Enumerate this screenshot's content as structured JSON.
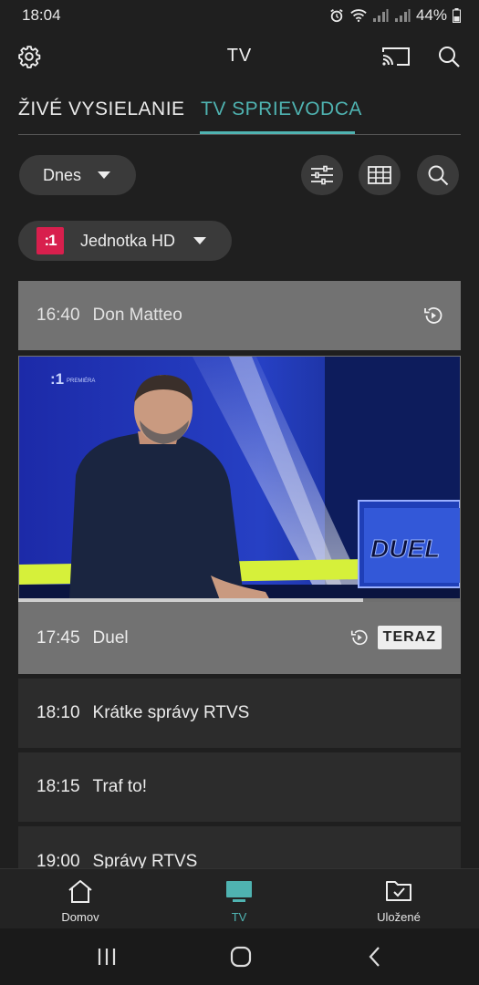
{
  "status_bar": {
    "time": "18:04",
    "battery": "44%",
    "icons": [
      "alarm-icon",
      "wifi-icon",
      "signal-icon",
      "signal-icon",
      "battery-icon"
    ]
  },
  "app_bar": {
    "title": "TV",
    "left_icon": "settings-gear-icon",
    "right_icons": [
      "cast-icon",
      "search-icon"
    ]
  },
  "tabs": [
    {
      "label": "ŽIVÉ VYSIELANIE",
      "active": false
    },
    {
      "label": "TV SPRIEVODCA",
      "active": true
    }
  ],
  "filters": {
    "day": "Dnes",
    "buttons": [
      "filter-sliders-icon",
      "grid-view-icon",
      "search-icon"
    ]
  },
  "channel": {
    "logo_text": ":1",
    "name": "Jednotka HD"
  },
  "programmes": {
    "past": {
      "time": "16:40",
      "name": "Don Matteo"
    },
    "current": {
      "time": "17:45",
      "name": "Duel",
      "badge": "TERAZ",
      "progress": 0.78,
      "thumbnail_logo": ":1",
      "thumbnail_tag": "PREMIÉRA",
      "thumbnail_set_text": "DUEL"
    },
    "upcoming": [
      {
        "time": "18:10",
        "name": "Krátke správy RTVS"
      },
      {
        "time": "18:15",
        "name": "Traf to!"
      },
      {
        "time": "19:00",
        "name": "Správy RTVS"
      }
    ]
  },
  "bottom_nav": [
    {
      "label": "Domov",
      "icon": "home-icon",
      "active": false
    },
    {
      "label": "TV",
      "icon": "tv-icon",
      "active": true
    },
    {
      "label": "Uložené",
      "icon": "saved-folder-icon",
      "active": false
    }
  ],
  "system_nav": [
    "recents-icon",
    "home-circle-icon",
    "back-icon"
  ],
  "colors": {
    "accent": "#4fb3b1",
    "background": "#1f1f1f",
    "channel_logo": "#d81f4d"
  }
}
